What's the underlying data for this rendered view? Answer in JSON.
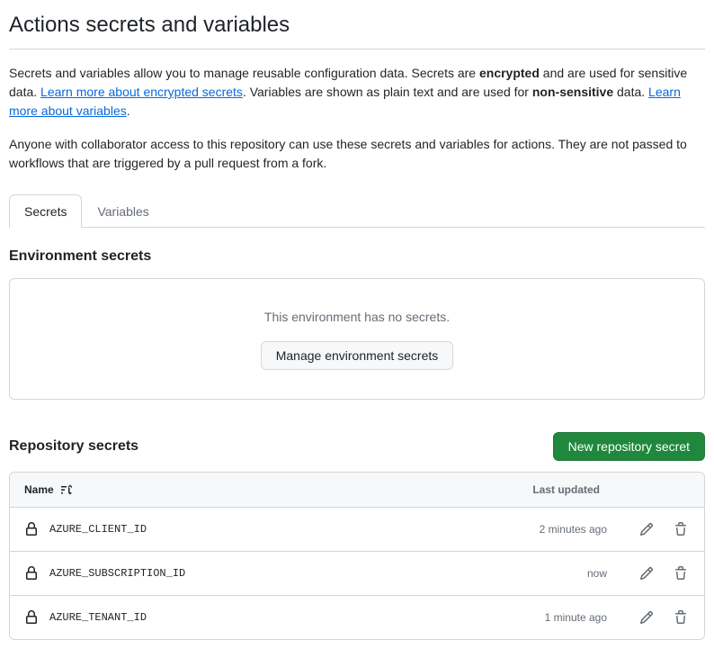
{
  "page": {
    "title": "Actions secrets and variables",
    "desc_prefix": "Secrets and variables allow you to manage reusable configuration data. Secrets are ",
    "desc_encrypted": "encrypted",
    "desc_mid1": " and are used for sensitive data. ",
    "link_secrets": "Learn more about encrypted secrets",
    "desc_mid2": ". Variables are shown as plain text and are used for ",
    "desc_nonsensitive": "non-sensitive",
    "desc_mid3": " data. ",
    "link_variables": "Learn more about variables",
    "desc_end": ".",
    "desc2": "Anyone with collaborator access to this repository can use these secrets and variables for actions. They are not passed to workflows that are triggered by a pull request from a fork."
  },
  "tabs": {
    "secrets": "Secrets",
    "variables": "Variables"
  },
  "env": {
    "heading": "Environment secrets",
    "empty": "This environment has no secrets.",
    "manage_btn": "Manage environment secrets"
  },
  "repo": {
    "heading": "Repository secrets",
    "new_btn": "New repository secret",
    "col_name": "Name",
    "col_updated": "Last updated",
    "rows": [
      {
        "name": "AZURE_CLIENT_ID",
        "updated": "2 minutes ago"
      },
      {
        "name": "AZURE_SUBSCRIPTION_ID",
        "updated": "now"
      },
      {
        "name": "AZURE_TENANT_ID",
        "updated": "1 minute ago"
      }
    ]
  }
}
